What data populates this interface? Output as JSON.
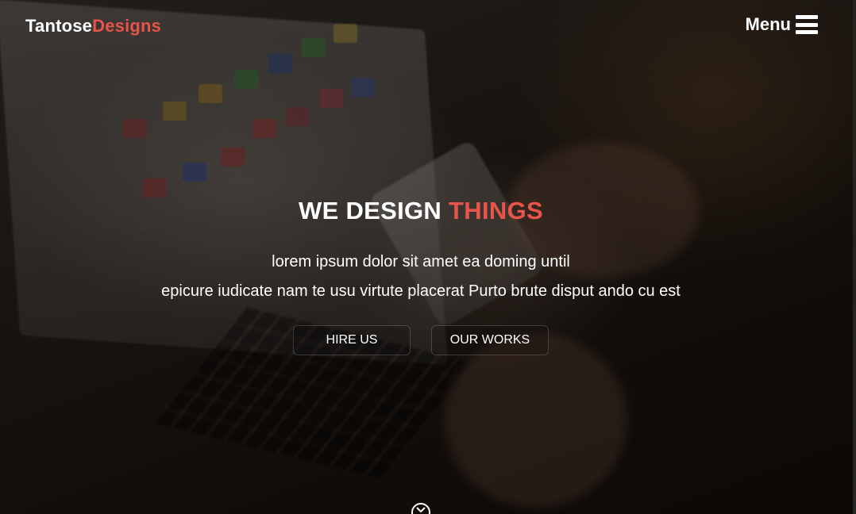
{
  "header": {
    "brand_primary": "Tantose",
    "brand_accent": "Designs",
    "menu_label": "Menu",
    "menu_icon": "hamburger-icon"
  },
  "hero": {
    "headline_primary": "WE DESIGN",
    "headline_accent": "THINGS",
    "tagline_line1": "lorem ipsum dolor sit amet ea doming until",
    "tagline_line2": "epicure iudicate nam te usu virtute placerat Purto brute disput ando cu est",
    "buttons": [
      {
        "label": "HIRE US"
      },
      {
        "label": "OUR WORKS"
      }
    ],
    "scroll_icon": "chevron-down-circle-icon"
  },
  "colors": {
    "accent": "#e8534a",
    "text": "#ffffff"
  }
}
